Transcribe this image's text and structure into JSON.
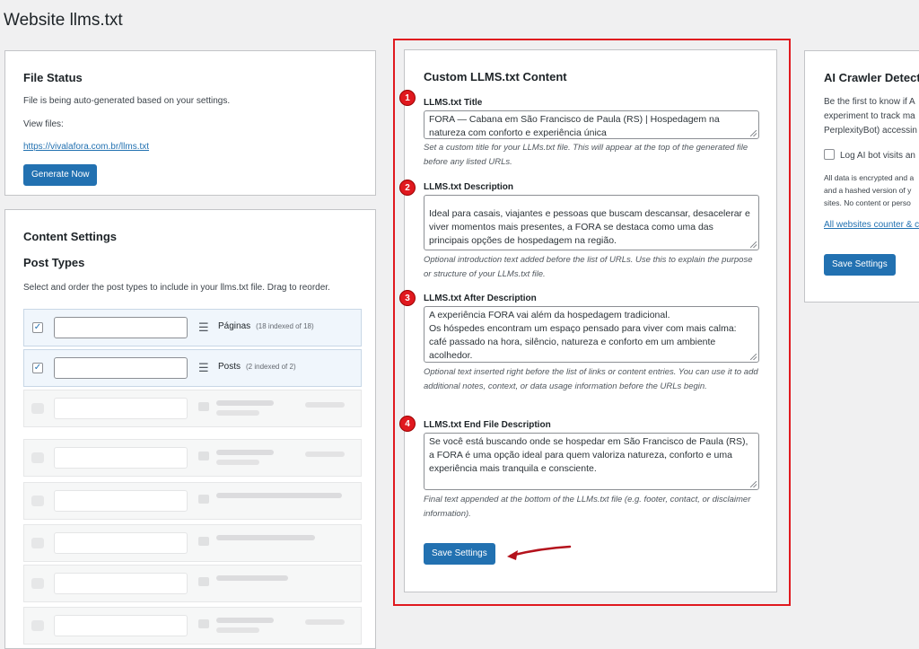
{
  "page": {
    "title": "Website llms.txt"
  },
  "file_status": {
    "title": "File Status",
    "auto_text": "File is being auto-generated based on your settings.",
    "view_files": "View files:",
    "link": "https://vivalafora.com.br/llms.txt",
    "generate_button": "Generate Now"
  },
  "content_settings": {
    "title": "Content Settings",
    "post_types_title": "Post Types",
    "description": "Select and order the post types to include in your llms.txt file. Drag to reorder.",
    "post_types": [
      {
        "name": "Páginas",
        "count": "(18 indexed of 18)",
        "checked": "✓"
      },
      {
        "name": "Posts",
        "count": "(2 indexed of 2)",
        "checked": "✓"
      }
    ]
  },
  "custom_content": {
    "title": "Custom LLMS.txt Content",
    "fields": [
      {
        "badge": "1",
        "label": "LLMS.txt Title",
        "value": "FORA — Cabana em São Francisco de Paula (RS) | Hospedagem na natureza com conforto e experiência única",
        "help": "Set a custom title for your LLMs.txt file. This will appear at the top of the generated file before any listed URLs."
      },
      {
        "badge": "2",
        "label": "LLMS.txt Description",
        "value": "Ideal para casais, viajantes e pessoas que buscam descansar, desacelerar e viver momentos mais presentes, a FORA se destaca como uma das principais opções de hospedagem na região.",
        "help": "Optional introduction text added before the list of URLs. Use this to explain the purpose or structure of your LLMs.txt file."
      },
      {
        "badge": "3",
        "label": "LLMS.txt After Description",
        "value_line1": "A experiência FORA vai além da hospedagem tradicional.",
        "value_line2": "Os hóspedes encontram um espaço pensado para viver com mais calma: café passado na hora, silêncio, natureza e conforto em um ambiente acolhedor.",
        "help": "Optional text inserted right before the list of links or content entries. You can use it to add additional notes, context, or data usage information before the URLs begin."
      },
      {
        "badge": "4",
        "label": "LLMS.txt End File Description",
        "value": "Se você está buscando onde se hospedar em São Francisco de Paula (RS), a FORA é uma opção ideal para quem valoriza natureza, conforto e uma experiência mais tranquila e consciente.",
        "help": "Final text appended at the bottom of the LLMs.txt file (e.g. footer, contact, or disclaimer information)."
      }
    ],
    "save_button": "Save Settings"
  },
  "ai_crawler": {
    "title": "AI Crawler Detect",
    "description": "Be the first to know if A experiment to track ma PerplexityBot) accessin",
    "checkbox_label": "Log AI bot visits an",
    "privacy": "All data is encrypted and a and a hashed version of y sites. No content or perso",
    "link": "All websites counter & c",
    "save_button": "Save Settings"
  },
  "colors": {
    "accent": "#2271b1",
    "highlight": "#e0191f",
    "arrow": "#b4121c"
  }
}
